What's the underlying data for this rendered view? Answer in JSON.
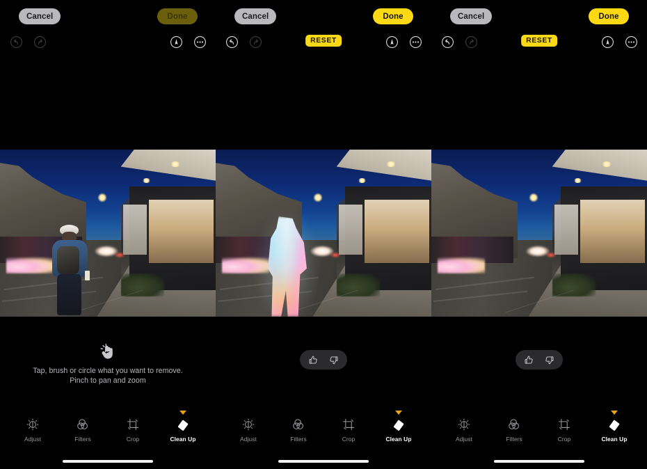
{
  "app": {
    "name": "Photos Editor — Clean Up",
    "background": "#000000",
    "accent_yellow": "#fcd913",
    "accent_yellow_dim": "#6b5f0b",
    "marker_orange": "#e8a317",
    "pill_gray": "#b9b9bd",
    "feedback_pill_gray": "#2b2b2e"
  },
  "panels": [
    {
      "id": "panel-before",
      "topbar": {
        "cancel_label": "Cancel",
        "done_label": "Done",
        "done_enabled": false,
        "undo_icon": "undo-icon",
        "redo_icon": "redo-icon",
        "undo_enabled": false,
        "redo_enabled": false,
        "markup_icon": "markup-pen-icon",
        "more_icon": "more-ellipsis-icon",
        "reset_label": "",
        "reset_visible": false
      },
      "photo": {
        "description": "Night city street at dusk with person in blue jacket and backpack walking away",
        "person_visible": true,
        "person_highlighted": false
      },
      "bottom": {
        "mode": "hint",
        "hint_icon": "tap-hand-icon",
        "hint_line1": "Tap, brush or circle what you want to remove.",
        "hint_line2": "Pinch to pan and zoom",
        "feedback_visible": false,
        "thumbs_up_icon": "thumbs-up-icon",
        "thumbs_down_icon": "thumbs-down-icon"
      },
      "tools": [
        {
          "label": "Adjust",
          "icon": "adjust-dial-icon",
          "active": false
        },
        {
          "label": "Filters",
          "icon": "filters-circles-icon",
          "active": false
        },
        {
          "label": "Crop",
          "icon": "crop-frame-icon",
          "active": false
        },
        {
          "label": "Clean Up",
          "icon": "cleanup-eraser-icon",
          "active": true
        }
      ]
    },
    {
      "id": "panel-selected",
      "topbar": {
        "cancel_label": "Cancel",
        "done_label": "Done",
        "done_enabled": true,
        "undo_icon": "undo-icon",
        "redo_icon": "redo-icon",
        "undo_enabled": true,
        "redo_enabled": false,
        "markup_icon": "markup-pen-icon",
        "more_icon": "more-ellipsis-icon",
        "reset_label": "RESET",
        "reset_visible": true
      },
      "photo": {
        "description": "Same street scene with the person glowing in an iridescent rainbow selection highlight",
        "person_visible": true,
        "person_highlighted": true
      },
      "bottom": {
        "mode": "feedback",
        "hint_icon": "tap-hand-icon",
        "hint_line1": "",
        "hint_line2": "",
        "feedback_visible": true,
        "thumbs_up_icon": "thumbs-up-icon",
        "thumbs_down_icon": "thumbs-down-icon"
      },
      "tools": [
        {
          "label": "Adjust",
          "icon": "adjust-dial-icon",
          "active": false
        },
        {
          "label": "Filters",
          "icon": "filters-circles-icon",
          "active": false
        },
        {
          "label": "Crop",
          "icon": "crop-frame-icon",
          "active": false
        },
        {
          "label": "Clean Up",
          "icon": "cleanup-eraser-icon",
          "active": true
        }
      ]
    },
    {
      "id": "panel-after",
      "topbar": {
        "cancel_label": "Cancel",
        "done_label": "Done",
        "done_enabled": true,
        "undo_icon": "undo-icon",
        "redo_icon": "redo-icon",
        "undo_enabled": true,
        "redo_enabled": false,
        "markup_icon": "markup-pen-icon",
        "more_icon": "more-ellipsis-icon",
        "reset_label": "RESET",
        "reset_visible": true
      },
      "photo": {
        "description": "Same street scene with the person removed, empty road and sidewalk",
        "person_visible": false,
        "person_highlighted": false
      },
      "bottom": {
        "mode": "feedback",
        "hint_icon": "tap-hand-icon",
        "hint_line1": "",
        "hint_line2": "",
        "feedback_visible": true,
        "thumbs_up_icon": "thumbs-up-icon",
        "thumbs_down_icon": "thumbs-down-icon"
      },
      "tools": [
        {
          "label": "Adjust",
          "icon": "adjust-dial-icon",
          "active": false
        },
        {
          "label": "Filters",
          "icon": "filters-circles-icon",
          "active": false
        },
        {
          "label": "Crop",
          "icon": "crop-frame-icon",
          "active": false
        },
        {
          "label": "Clean Up",
          "icon": "cleanup-eraser-icon",
          "active": true
        }
      ]
    }
  ]
}
